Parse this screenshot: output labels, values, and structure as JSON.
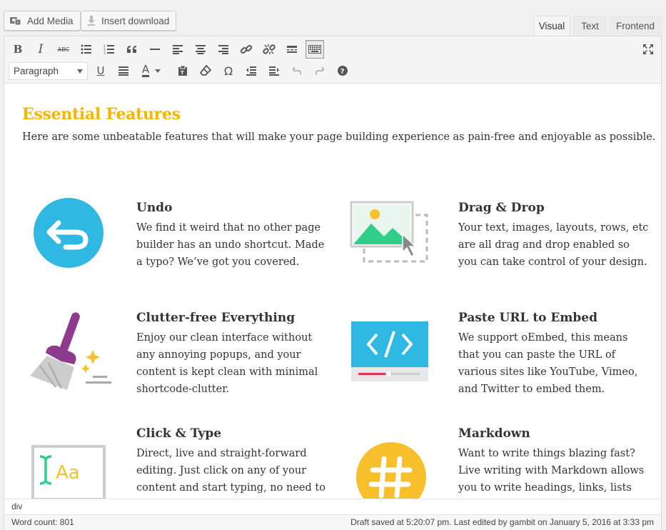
{
  "media_buttons": {
    "add_media": "Add Media",
    "insert_download": "Insert download"
  },
  "editor_tabs": {
    "visual": "Visual",
    "text": "Text",
    "frontend": "Frontend"
  },
  "toolbar": {
    "format_select": "Paragraph",
    "row1_icons": [
      "bold-icon",
      "italic-icon",
      "strikethrough-icon",
      "bullet-list-icon",
      "numbered-list-icon",
      "blockquote-icon",
      "horizontal-rule-icon",
      "align-left-icon",
      "align-center-icon",
      "align-right-icon",
      "insert-link-icon",
      "remove-link-icon",
      "read-more-icon",
      "toolbar-toggle-icon",
      "fullscreen-icon"
    ],
    "row2_icons": [
      "underline-icon",
      "justify-icon",
      "text-color-icon",
      "paste-text-icon",
      "clear-formatting-icon",
      "special-character-icon",
      "outdent-icon",
      "indent-icon",
      "undo-icon",
      "redo-icon",
      "help-icon"
    ],
    "bold_glyph": "B",
    "italic_glyph": "I",
    "strike_glyph": "ABC",
    "underline_glyph": "U",
    "omega_glyph": "Ω",
    "textcolor_glyph": "A"
  },
  "content": {
    "headline": "Essential Features",
    "intro": "Here are some unbeatable features that will make your page building experience as pain-free and enjoyable as possible.",
    "accent_color": "#f7b500",
    "features": [
      {
        "title": "Undo",
        "text": "We find it weird that no other page builder has an undo shortcut. Made a typo? We’ve got you covered.",
        "icon": "undo-icon"
      },
      {
        "title": "Drag & Drop",
        "text": "Your text, images, layouts, rows, etc are all drag and drop enabled so you can take control of your design.",
        "icon": "drag-drop-image-icon"
      },
      {
        "title": "Clutter-free Everything",
        "text": "Enjoy our clean interface without any annoying popups, and your content is kept clean with minimal shortcode-clutter.",
        "icon": "broom-icon"
      },
      {
        "title": "Paste URL to Embed",
        "text": "We support oEmbed, this means that you can paste the URL of various sites like YouTube, Vimeo, and Twitter to embed them.",
        "icon": "code-embed-icon"
      },
      {
        "title": "Click & Type",
        "text": "Direct, live and straight-forward editing. Just click on any of your content and start typing, no need to",
        "icon": "text-cursor-icon"
      },
      {
        "title": "Markdown",
        "text": "Want to write things blazing fast? Live writing with Markdown allows you to write headings, links, lists",
        "icon": "hashtag-icon"
      }
    ]
  },
  "status": {
    "path": "div",
    "word_count": "Word count: 801",
    "draft_info": "Draft saved at 5:20:07 pm. Last edited by gambit on January 5, 2016 at 3:33 pm"
  }
}
